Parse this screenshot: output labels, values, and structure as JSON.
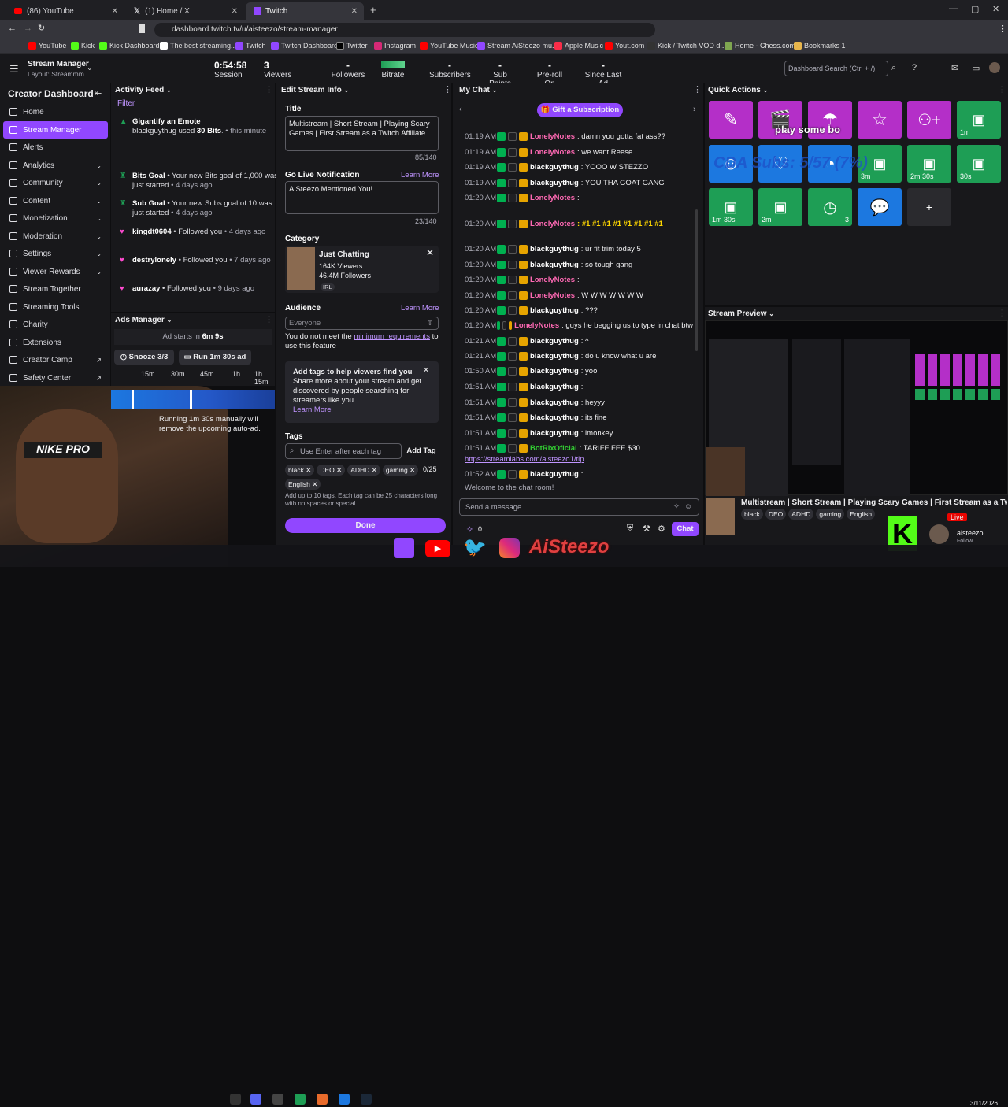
{
  "browser": {
    "tabs": [
      {
        "title": "(86) YouTube"
      },
      {
        "title": "(1) Home / X"
      },
      {
        "title": "Twitch"
      }
    ],
    "url": "dashboard.twitch.tv/u/aisteezo/stream-manager",
    "bookmarks": [
      "YouTube",
      "Kick",
      "Kick Dashboard",
      "The best streaming...",
      "Twitch",
      "Twitch Dashboard",
      "Twitter",
      "Instagram",
      "YouTube Music",
      "Stream AiSteezo mu...",
      "Apple Music",
      "Yout.com",
      "Kick / Twitch VOD d...",
      "Home - Chess.com",
      "Bookmarks 1"
    ]
  },
  "topbar": {
    "title": "Stream Manager",
    "layout": "Layout: Streammm",
    "session_value": "0:54:58",
    "session_label": "Session",
    "viewers_value": "3",
    "viewers_label": "Viewers",
    "followers_value": "-",
    "followers_label": "Followers",
    "bitrate_label": "Bitrate",
    "subscribers_value": "-",
    "subscribers_label": "Subscribers",
    "subpoints_value": "-",
    "subpoints_label": "Sub Points",
    "preroll_value": "-",
    "preroll_label": "Pre-roll On",
    "sincead_value": "-",
    "sincead_label": "Since Last Ad",
    "search_placeholder": "Dashboard Search (Ctrl + /)"
  },
  "sidebar": {
    "title": "Creator Dashboard",
    "items": [
      {
        "label": "Home"
      },
      {
        "label": "Stream Manager"
      },
      {
        "label": "Alerts"
      },
      {
        "label": "Analytics"
      },
      {
        "label": "Community"
      },
      {
        "label": "Content"
      },
      {
        "label": "Monetization"
      },
      {
        "label": "Moderation"
      },
      {
        "label": "Settings"
      },
      {
        "label": "Viewer Rewards"
      },
      {
        "label": "Stream Together"
      },
      {
        "label": "Streaming Tools"
      },
      {
        "label": "Charity"
      },
      {
        "label": "Extensions"
      },
      {
        "label": "Creator Camp"
      },
      {
        "label": "Safety Center"
      }
    ]
  },
  "activity": {
    "title": "Activity Feed",
    "filter": "Filter",
    "items": [
      {
        "name": "Gigantify an Emote",
        "body": "blackguythug used ",
        "bold2": "30 Bits",
        "tail": ". • this minute"
      },
      {
        "name": "Bits Goal",
        "body": " • Your new Bits goal of 1,000 was just started",
        "time": " • 4 days ago"
      },
      {
        "name": "Sub Goal",
        "body": " • Your new Subs goal of 10 was just started",
        "time": " • 4 days ago"
      },
      {
        "name": "kingdt0604",
        "body": " • Followed you",
        "time": " • 4 days ago"
      },
      {
        "name": "destrylonely",
        "body": " • Followed you",
        "time": " • 7 days ago"
      },
      {
        "name": "aurazay",
        "body": " • Followed you",
        "time": " • 9 days ago"
      }
    ]
  },
  "ads": {
    "title": "Ads Manager",
    "starts_label": "Ad starts in",
    "starts_value": "6m 9s",
    "snooze": "Snooze 3/3",
    "run": "Run 1m 30s ad",
    "ticks": [
      "15m",
      "30m",
      "45m",
      "1h",
      "1h 15m"
    ],
    "note": "Running 1m 30s manually will remove the upcoming auto-ad."
  },
  "edit": {
    "title": "Edit Stream Info",
    "title_label": "Title",
    "title_value": "Multistream | Short Stream | Playing Scary Games | First Stream as a Twitch Affiliate",
    "title_count": "85/140",
    "golive_label": "Go Live Notification",
    "learn_more": "Learn More",
    "golive_value": "AiSteezo Mentioned You!",
    "golive_count": "23/140",
    "category_label": "Category",
    "category_name": "Just Chatting",
    "category_viewers": "164K Viewers",
    "category_followers": "46.4M Followers",
    "category_tag": "IRL",
    "audience_label": "Audience",
    "audience_value": "Everyone",
    "audience_note_a": "You do not meet the ",
    "audience_note_link": "minimum requirements",
    "audience_note_b": " to use this feature",
    "tags_tip": "Add tags to help viewers find you",
    "tags_tip_body": "Share more about your stream and get discovered by people searching for streamers like you.",
    "tags_label": "Tags",
    "tags_placeholder": "Use Enter after each tag",
    "add_tag": "Add Tag",
    "tags": [
      "black",
      "DEO",
      "ADHD",
      "gaming",
      "English"
    ],
    "tag_count": "0/25",
    "tags_note": "Add up to 10 tags. Each tag can be 25 characters long with no spaces or special",
    "done": "Done"
  },
  "chat": {
    "title": "My Chat",
    "gift": "Gift a Subscription",
    "lines": [
      {
        "t": "01:19 AM",
        "u": "LonelyNotes",
        "c": "pink",
        "m": ": damn you gotta fat ass??"
      },
      {
        "t": "01:19 AM",
        "u": "LonelyNotes",
        "c": "pink",
        "m": ": we want Reese"
      },
      {
        "t": "01:19 AM",
        "u": "blackguythug",
        "c": "white",
        "m": ": YOOO W STEZZO"
      },
      {
        "t": "01:19 AM",
        "u": "blackguythug",
        "c": "white",
        "m": ": YOU THA GOAT GANG"
      },
      {
        "t": "01:20 AM",
        "u": "LonelyNotes",
        "c": "pink",
        "m": ":"
      },
      {
        "t": "01:20 AM",
        "u": "LonelyNotes",
        "c": "pink",
        "m": ": #1 #1 #1 #1 #1 #1 #1 #1"
      },
      {
        "t": "01:20 AM",
        "u": "blackguythug",
        "c": "white",
        "m": ": ur fit trim today 5"
      },
      {
        "t": "01:20 AM",
        "u": "blackguythug",
        "c": "white",
        "m": ": so tough gang"
      },
      {
        "t": "01:20 AM",
        "u": "LonelyNotes",
        "c": "pink",
        "m": ":"
      },
      {
        "t": "01:20 AM",
        "u": "LonelyNotes",
        "c": "pink",
        "m": ": W W W W W W W"
      },
      {
        "t": "01:20 AM",
        "u": "blackguythug",
        "c": "white",
        "m": ": ???"
      },
      {
        "t": "01:20 AM",
        "u": "LonelyNotes",
        "c": "pink",
        "m": ": guys he begging us to type in chat btw"
      },
      {
        "t": "01:21 AM",
        "u": "blackguythug",
        "c": "white",
        "m": ": ^"
      },
      {
        "t": "01:21 AM",
        "u": "blackguythug",
        "c": "white",
        "m": ": do u know what u are"
      },
      {
        "t": "01:50 AM",
        "u": "blackguythug",
        "c": "white",
        "m": ": yoo"
      },
      {
        "t": "01:51 AM",
        "u": "blackguythug",
        "c": "white",
        "m": ":"
      },
      {
        "t": "01:51 AM",
        "u": "blackguythug",
        "c": "white",
        "m": ": heyyy"
      },
      {
        "t": "01:51 AM",
        "u": "blackguythug",
        "c": "white",
        "m": ": its fine"
      },
      {
        "t": "01:51 AM",
        "u": "blackguythug",
        "c": "white",
        "m": ": lmonkey"
      },
      {
        "t": "01:51 AM",
        "u": "BotRixOficial",
        "c": "green",
        "m": ": TARIFF FEE $30"
      },
      {
        "t": "01:52 AM",
        "u": "blackguythug",
        "c": "white",
        "m": ":"
      }
    ],
    "tariff_link": "https://streamlabs.com/aisteezo1/tip",
    "welcome": "Welcome to the chat room!",
    "input_placeholder": "Send a message",
    "points": "0",
    "chat_button": "Chat"
  },
  "quick": {
    "title": "Quick Actions",
    "overlay_text": "play some bo",
    "cda_text": "CDA Subs: 5/57 (7%)",
    "captions": [
      "1m",
      "3m",
      "2m 30s",
      "30s",
      "1m 30s",
      "2m",
      "3"
    ]
  },
  "preview": {
    "title": "Stream Preview",
    "stream_title": "Multistream | Short Stream | Playing Scary Games | First Stream as a Twitch Aff",
    "tags": [
      "black",
      "DEO",
      "ADHD",
      "gaming",
      "English"
    ],
    "live": "Live",
    "channel": "aisteezo",
    "follow": "Follow"
  },
  "overlay": {
    "brand_text": "AiSteezo",
    "date": "3/11/2026"
  },
  "colors": {
    "accent": "#9147ff",
    "quick_purple": "#b42fc8",
    "quick_blue": "#1c78e0",
    "quick_green": "#1e9e55"
  }
}
